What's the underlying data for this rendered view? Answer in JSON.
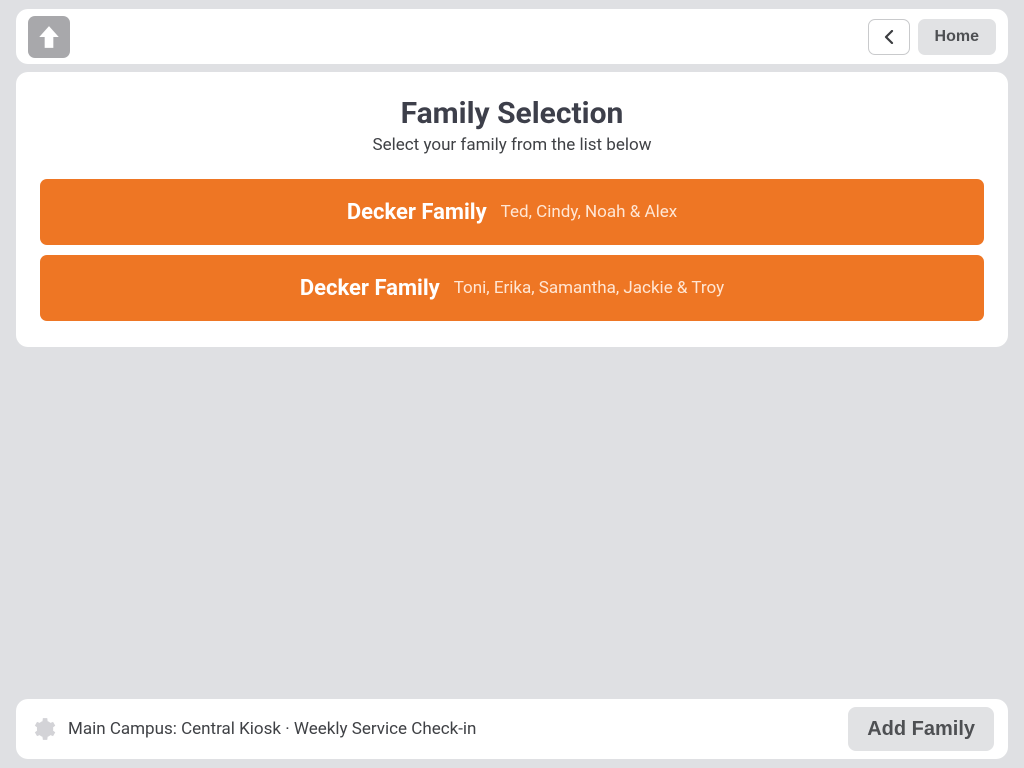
{
  "header": {
    "home_label": "Home"
  },
  "page": {
    "title": "Family Selection",
    "subtitle": "Select your family from the list below"
  },
  "families": [
    {
      "name": "Decker Family",
      "members": "Ted, Cindy, Noah & Alex"
    },
    {
      "name": "Decker Family",
      "members": "Toni, Erika, Samantha, Jackie & Troy"
    }
  ],
  "footer": {
    "status": "Main Campus: Central Kiosk · Weekly Service Check-in",
    "add_family_label": "Add Family"
  },
  "colors": {
    "accent": "#ee7624",
    "page_bg": "#dfe0e3"
  }
}
